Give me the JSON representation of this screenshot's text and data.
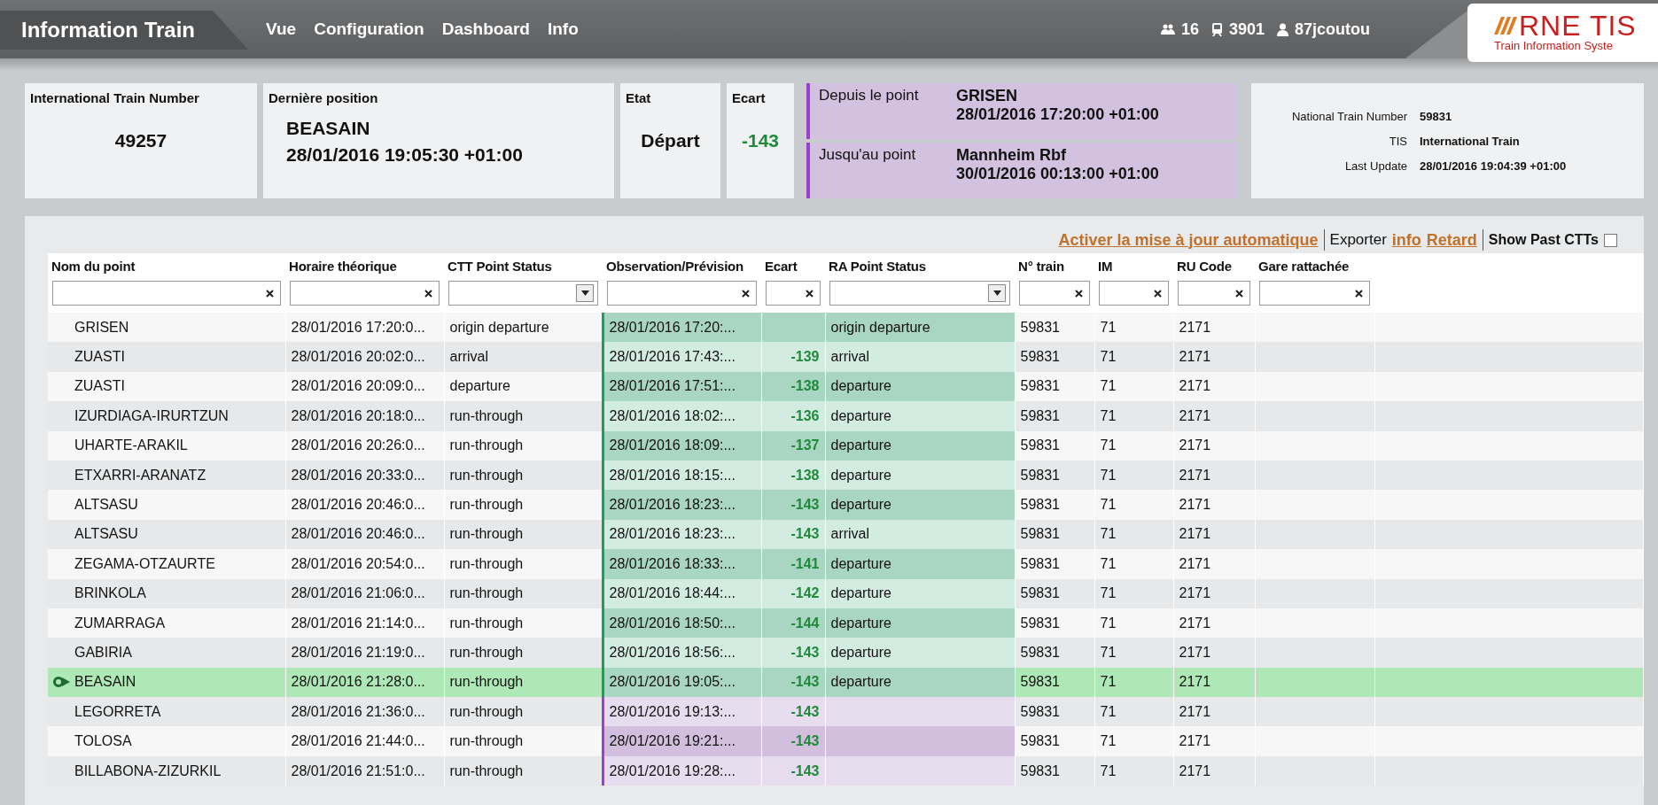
{
  "header": {
    "title": "Information Train",
    "nav": [
      "Vue",
      "Configuration",
      "Dashboard",
      "Info"
    ],
    "stats": [
      {
        "kind": "users",
        "value": "16"
      },
      {
        "kind": "trains",
        "value": "3901"
      },
      {
        "kind": "user",
        "value": "87jcoutou"
      }
    ],
    "logo": {
      "name": "RNE TIS",
      "tagline": "Train Information Syste"
    }
  },
  "summary": {
    "international_train_number": {
      "label": "International Train Number",
      "value": "49257"
    },
    "last_position": {
      "label": "Dernière position",
      "station": "BEASAIN",
      "time": "28/01/2016 19:05:30 +01:00"
    },
    "state": {
      "label": "Etat",
      "value": "Départ"
    },
    "deviation": {
      "label": "Ecart",
      "value": "-143"
    },
    "route": [
      {
        "label": "Depuis le point",
        "station": "GRISEN",
        "time": "28/01/2016 17:20:00 +01:00"
      },
      {
        "label": "Jusqu'au point",
        "station": "Mannheim Rbf",
        "time": "30/01/2016 00:13:00 +01:00"
      }
    ],
    "details": [
      {
        "label": "National Train Number",
        "value": "59831"
      },
      {
        "label": "TIS",
        "value": "International Train"
      },
      {
        "label": "Last Update",
        "value": "28/01/2016 19:04:39 +01:00"
      }
    ]
  },
  "toolbar": {
    "items": [
      {
        "kind": "link",
        "text": "Activer la mise à jour automatique"
      },
      {
        "kind": "divider"
      },
      {
        "kind": "plain",
        "text": "Exporter"
      },
      {
        "kind": "link",
        "text": "info"
      },
      {
        "kind": "link",
        "text": "Retard"
      },
      {
        "kind": "divider"
      }
    ],
    "show_past": {
      "label": "Show Past CTTs",
      "checked": false
    }
  },
  "table": {
    "columns": [
      {
        "title": "Nom du point",
        "kind": "text"
      },
      {
        "title": "Horaire théorique",
        "kind": "text"
      },
      {
        "title": "CTT Point Status",
        "kind": "select"
      },
      {
        "title": "Observation/Prévision",
        "kind": "text"
      },
      {
        "title": "Ecart",
        "kind": "text"
      },
      {
        "title": "RA Point Status",
        "kind": "select"
      },
      {
        "title": "N° train",
        "kind": "text"
      },
      {
        "title": "IM",
        "kind": "text"
      },
      {
        "title": "RU Code",
        "kind": "text"
      },
      {
        "title": "Gare rattachée",
        "kind": "text"
      }
    ],
    "rows": [
      {
        "name": "GRISEN",
        "planned": "28/01/2016 17:20:0...",
        "ctt_status": "origin departure",
        "observed": "28/01/2016 17:20:...",
        "ra_status": "origin departure",
        "train": "59831",
        "im": "71",
        "ru_code": "2171",
        "kind": "past"
      },
      {
        "name": "ZUASTI",
        "planned": "28/01/2016 20:02:0...",
        "ctt_status": "arrival",
        "observed": "28/01/2016 17:43:...",
        "deviation": "-139",
        "ra_status": "arrival",
        "train": "59831",
        "im": "71",
        "ru_code": "2171",
        "kind": "past"
      },
      {
        "name": "ZUASTI",
        "planned": "28/01/2016 20:09:0...",
        "ctt_status": "departure",
        "observed": "28/01/2016 17:51:...",
        "deviation": "-138",
        "ra_status": "departure",
        "train": "59831",
        "im": "71",
        "ru_code": "2171",
        "kind": "past"
      },
      {
        "name": "IZURDIAGA-IRURTZUN",
        "planned": "28/01/2016 20:18:0...",
        "ctt_status": "run-through",
        "observed": "28/01/2016 18:02:...",
        "deviation": "-136",
        "ra_status": "departure",
        "train": "59831",
        "im": "71",
        "ru_code": "2171",
        "kind": "past"
      },
      {
        "name": "UHARTE-ARAKIL",
        "planned": "28/01/2016 20:26:0...",
        "ctt_status": "run-through",
        "observed": "28/01/2016 18:09:...",
        "deviation": "-137",
        "ra_status": "departure",
        "train": "59831",
        "im": "71",
        "ru_code": "2171",
        "kind": "past"
      },
      {
        "name": "ETXARRI-ARANATZ",
        "planned": "28/01/2016 20:33:0...",
        "ctt_status": "run-through",
        "observed": "28/01/2016 18:15:...",
        "deviation": "-138",
        "ra_status": "departure",
        "train": "59831",
        "im": "71",
        "ru_code": "2171",
        "kind": "past"
      },
      {
        "name": "ALTSASU",
        "planned": "28/01/2016 20:46:0...",
        "ctt_status": "run-through",
        "observed": "28/01/2016 18:23:...",
        "deviation": "-143",
        "ra_status": "departure",
        "train": "59831",
        "im": "71",
        "ru_code": "2171",
        "kind": "past"
      },
      {
        "name": "ALTSASU",
        "planned": "28/01/2016 20:46:0...",
        "ctt_status": "run-through",
        "observed": "28/01/2016 18:23:...",
        "deviation": "-143",
        "ra_status": "arrival",
        "train": "59831",
        "im": "71",
        "ru_code": "2171",
        "kind": "past"
      },
      {
        "name": "ZEGAMA-OTZAURTE",
        "planned": "28/01/2016 20:54:0...",
        "ctt_status": "run-through",
        "observed": "28/01/2016 18:33:...",
        "deviation": "-141",
        "ra_status": "departure",
        "train": "59831",
        "im": "71",
        "ru_code": "2171",
        "kind": "past"
      },
      {
        "name": "BRINKOLA",
        "planned": "28/01/2016 21:06:0...",
        "ctt_status": "run-through",
        "observed": "28/01/2016 18:44:...",
        "deviation": "-142",
        "ra_status": "departure",
        "train": "59831",
        "im": "71",
        "ru_code": "2171",
        "kind": "past"
      },
      {
        "name": "ZUMARRAGA",
        "planned": "28/01/2016 21:14:0...",
        "ctt_status": "run-through",
        "observed": "28/01/2016 18:50:...",
        "deviation": "-144",
        "ra_status": "departure",
        "train": "59831",
        "im": "71",
        "ru_code": "2171",
        "kind": "past"
      },
      {
        "name": "GABIRIA",
        "planned": "28/01/2016 21:19:0...",
        "ctt_status": "run-through",
        "observed": "28/01/2016 18:56:...",
        "deviation": "-143",
        "ra_status": "departure",
        "train": "59831",
        "im": "71",
        "ru_code": "2171",
        "kind": "past"
      },
      {
        "name": "BEASAIN",
        "planned": "28/01/2016 21:28:0...",
        "ctt_status": "run-through",
        "observed": "28/01/2016 19:05:...",
        "deviation": "-143",
        "ra_status": "departure",
        "train": "59831",
        "im": "71",
        "ru_code": "2171",
        "kind": "current"
      },
      {
        "name": "LEGORRETA",
        "planned": "28/01/2016 21:36:0...",
        "ctt_status": "run-through",
        "observed": "28/01/2016 19:13:...",
        "deviation": "-143",
        "train": "59831",
        "im": "71",
        "ru_code": "2171",
        "kind": "future"
      },
      {
        "name": "TOLOSA",
        "planned": "28/01/2016 21:44:0...",
        "ctt_status": "run-through",
        "observed": "28/01/2016 19:21:...",
        "deviation": "-143",
        "train": "59831",
        "im": "71",
        "ru_code": "2171",
        "kind": "future"
      },
      {
        "name": "BILLABONA-ZIZURKIL",
        "planned": "28/01/2016 21:51:0...",
        "ctt_status": "run-through",
        "observed": "28/01/2016 19:28:...",
        "deviation": "-143",
        "train": "59831",
        "im": "71",
        "ru_code": "2171",
        "kind": "future"
      }
    ]
  }
}
